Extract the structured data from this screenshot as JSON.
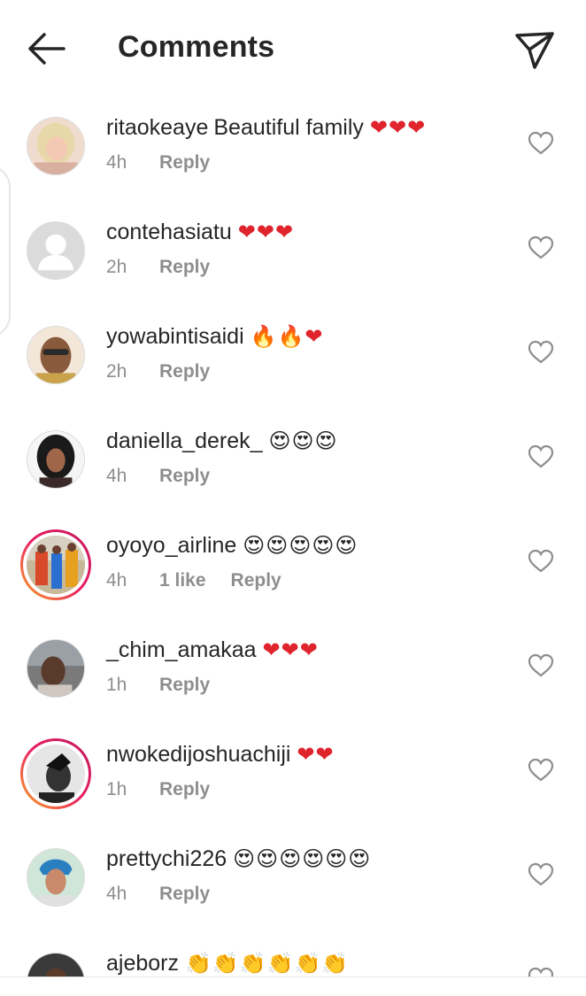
{
  "header": {
    "title": "Comments",
    "back_icon": "back-arrow-icon",
    "send_icon": "paper-plane-icon"
  },
  "comments": [
    {
      "username": "ritaokeaye",
      "text": "Beautiful family",
      "emoji": "❤❤❤",
      "time": "4h",
      "reply": "Reply",
      "avatar": "avatar-woman-blonde"
    },
    {
      "username": "contehasiatu",
      "text": "",
      "emoji": "❤❤❤",
      "time": "2h",
      "reply": "Reply",
      "avatar": "avatar-default"
    },
    {
      "username": "yowabintisaidi",
      "text": "",
      "emoji": "🔥🔥❤",
      "time": "2h",
      "reply": "Reply",
      "avatar": "avatar-woman-glasses"
    },
    {
      "username": "daniella_derek_",
      "text": "",
      "emoji": "😍😍😍",
      "time": "4h",
      "reply": "Reply",
      "avatar": "avatar-woman-dark-hair"
    },
    {
      "username": "oyoyo_airline",
      "text": "",
      "emoji": "😍😍😍😍😍",
      "time": "4h",
      "likes": "1 like",
      "reply": "Reply",
      "avatar": "avatar-group-photo"
    },
    {
      "username": "_chim_amakaa",
      "text": "",
      "emoji": "❤❤❤",
      "time": "1h",
      "reply": "Reply",
      "avatar": "avatar-woman-street"
    },
    {
      "username": "nwokedijoshuachiji",
      "text": "",
      "emoji": "❤❤",
      "time": "1h",
      "reply": "Reply",
      "avatar": "avatar-man-bw"
    },
    {
      "username": "prettychi226",
      "text": "",
      "emoji": "😍😍😍😍😍😍",
      "time": "4h",
      "reply": "Reply",
      "avatar": "avatar-woman-headwrap"
    },
    {
      "username": "ajeborz",
      "text": "",
      "emoji": "👏👏👏👏👏👏",
      "time": "",
      "reply": "",
      "avatar": "avatar-man-dark"
    }
  ],
  "colors": {
    "text": "#262626",
    "muted": "#8e8e8e",
    "heart": "#e0242c",
    "story_ring_start": "#f9a825",
    "story_ring_end": "#c2185b"
  }
}
